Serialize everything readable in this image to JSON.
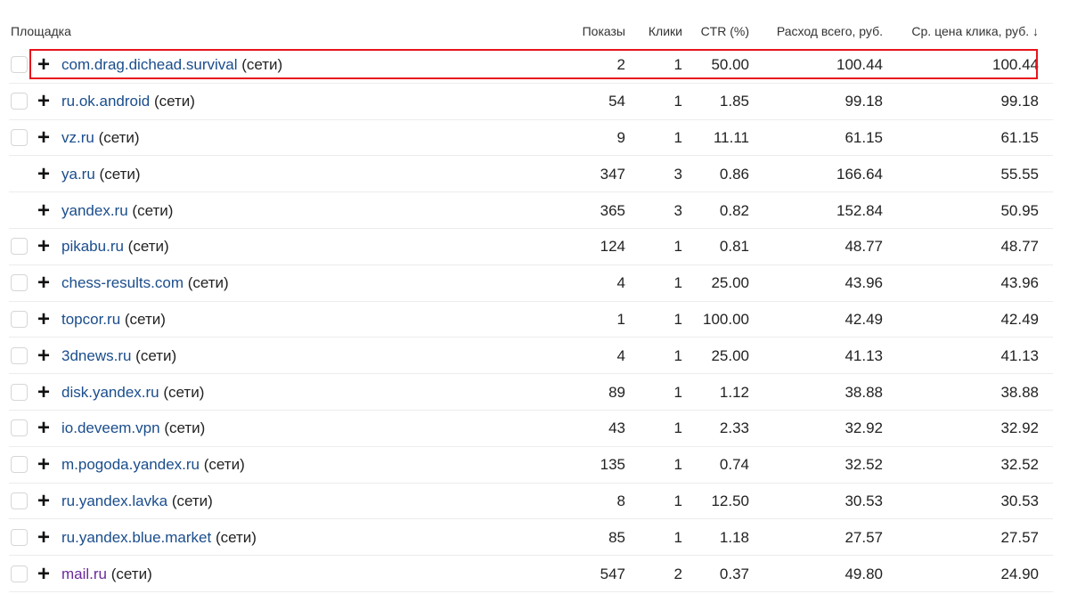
{
  "header": {
    "site": "Площадка",
    "shows": "Показы",
    "clicks": "Клики",
    "ctr": "CTR (%)",
    "spend": "Расход всего, руб.",
    "cpc": "Ср. цена клика, руб. ↓"
  },
  "rows": [
    {
      "site": "com.drag.dichead.survival",
      "suffix": "(сети)",
      "shows": "2",
      "clicks": "1",
      "ctr": "50.00",
      "spend": "100.44",
      "cpc": "100.44",
      "checkbox": true
    },
    {
      "site": "ru.ok.android",
      "suffix": "(сети)",
      "shows": "54",
      "clicks": "1",
      "ctr": "1.85",
      "spend": "99.18",
      "cpc": "99.18",
      "checkbox": true
    },
    {
      "site": "vz.ru",
      "suffix": "(сети)",
      "shows": "9",
      "clicks": "1",
      "ctr": "11.11",
      "spend": "61.15",
      "cpc": "61.15",
      "checkbox": true
    },
    {
      "site": "ya.ru",
      "suffix": "(сети)",
      "shows": "347",
      "clicks": "3",
      "ctr": "0.86",
      "spend": "166.64",
      "cpc": "55.55",
      "checkbox": false
    },
    {
      "site": "yandex.ru",
      "suffix": "(сети)",
      "shows": "365",
      "clicks": "3",
      "ctr": "0.82",
      "spend": "152.84",
      "cpc": "50.95",
      "checkbox": false
    },
    {
      "site": "pikabu.ru",
      "suffix": "(сети)",
      "shows": "124",
      "clicks": "1",
      "ctr": "0.81",
      "spend": "48.77",
      "cpc": "48.77",
      "checkbox": true
    },
    {
      "site": "chess-results.com",
      "suffix": "(сети)",
      "shows": "4",
      "clicks": "1",
      "ctr": "25.00",
      "spend": "43.96",
      "cpc": "43.96",
      "checkbox": true
    },
    {
      "site": "topcor.ru",
      "suffix": "(сети)",
      "shows": "1",
      "clicks": "1",
      "ctr": "100.00",
      "spend": "42.49",
      "cpc": "42.49",
      "checkbox": true
    },
    {
      "site": "3dnews.ru",
      "suffix": "(сети)",
      "shows": "4",
      "clicks": "1",
      "ctr": "25.00",
      "spend": "41.13",
      "cpc": "41.13",
      "checkbox": true
    },
    {
      "site": "disk.yandex.ru",
      "suffix": "(сети)",
      "shows": "89",
      "clicks": "1",
      "ctr": "1.12",
      "spend": "38.88",
      "cpc": "38.88",
      "checkbox": true
    },
    {
      "site": "io.deveem.vpn",
      "suffix": "(сети)",
      "shows": "43",
      "clicks": "1",
      "ctr": "2.33",
      "spend": "32.92",
      "cpc": "32.92",
      "checkbox": true
    },
    {
      "site": "m.pogoda.yandex.ru",
      "suffix": "(сети)",
      "shows": "135",
      "clicks": "1",
      "ctr": "0.74",
      "spend": "32.52",
      "cpc": "32.52",
      "checkbox": true
    },
    {
      "site": "ru.yandex.lavka",
      "suffix": "(сети)",
      "shows": "8",
      "clicks": "1",
      "ctr": "12.50",
      "spend": "30.53",
      "cpc": "30.53",
      "checkbox": true
    },
    {
      "site": "ru.yandex.blue.market",
      "suffix": "(сети)",
      "shows": "85",
      "clicks": "1",
      "ctr": "1.18",
      "spend": "27.57",
      "cpc": "27.57",
      "checkbox": true
    },
    {
      "site": "mail.ru",
      "suffix": "(сети)",
      "shows": "547",
      "clicks": "2",
      "ctr": "0.37",
      "spend": "49.80",
      "cpc": "24.90",
      "checkbox": true,
      "visited": true
    }
  ],
  "colors": {
    "link": "#1a4d8c",
    "visited_link": "#6b2a9a",
    "highlight": "#e8141c"
  },
  "icons": {
    "expand": "plus-icon"
  }
}
